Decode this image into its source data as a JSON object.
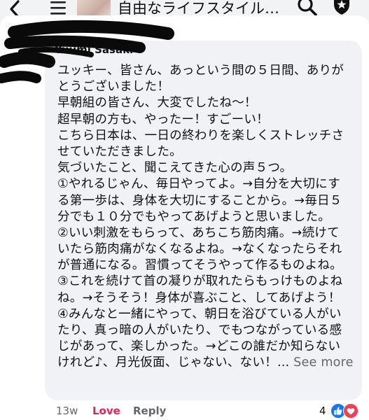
{
  "header": {
    "group_title": "自由なライフスタイル…"
  },
  "comment": {
    "author": "Yuumi Sasaki",
    "lines": [
      "ユッキー、皆さん、あっという間の５日間、ありが",
      "とうございました！",
      "早朝組の皆さん、大変でしたね〜！",
      "超早朝の方も、やったー！すごーい！",
      "こちら日本は、一日の終わりを楽しくストレッチさ",
      "せていただきました。",
      "気づいたこと、聞こえてきた心の声５つ。",
      "①やれるじゃん、毎日やってよ。→自分を大切にす",
      "る第一歩は、身体を大切にすることから。→毎日５",
      "分でも１０分でもやってあげようと思いました。",
      "②いい刺激をもらって、あちこち筋肉痛。→続けて",
      "いたら筋肉痛がなくなるよね。→なくなったらそれ",
      "が普通になる。習慣ってそうやって作るものよね。",
      "③これを続けて首の凝りが取れたらもっけものよね",
      "ね。→そうそう！身体が喜ぶこと、してあげよう！",
      "④みんなと一緒にやって、朝日を浴びている人がい",
      "たり、真っ暗の人がいたり、でもつながっている感",
      "じがあって、楽しかった。→どこの誰だか知らない"
    ],
    "last_line": "けれど♪、月光仮面、じゃない、ない！",
    "ellipsis": "...",
    "see_more": "See more"
  },
  "actions": {
    "time": "13w",
    "love": "Love",
    "reply": "Reply",
    "reaction_count": "4"
  },
  "icons": {
    "back": "chevron-left-icon",
    "menu": "hamburger-icon",
    "search": "search-icon",
    "shield": "shield-icon",
    "like": "like-icon",
    "heart": "heart-icon"
  },
  "colors": {
    "like_blue": "#1877f2",
    "love_red": "#e0245e",
    "bubble_bg": "#f0f2f5",
    "muted_text": "#65676b"
  }
}
